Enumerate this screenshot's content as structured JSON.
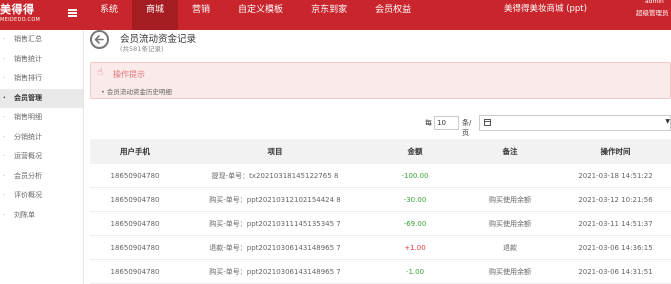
{
  "brand": {
    "name": "美得得",
    "sub": "MEIDEDO.COM"
  },
  "topnav": {
    "items": [
      {
        "label": "系统",
        "active": false
      },
      {
        "label": "商城",
        "active": true
      },
      {
        "label": "营销",
        "active": false
      },
      {
        "label": "自定义模板",
        "active": false
      },
      {
        "label": "京东到家",
        "active": false
      },
      {
        "label": "会员权益",
        "active": false
      }
    ],
    "store": "美得得美妆商城 (ppt)",
    "admin_name": "admin",
    "admin_role": "超级管理员"
  },
  "sidebar": {
    "items": [
      {
        "label": "销售汇总",
        "active": false
      },
      {
        "label": "销售统计",
        "active": false
      },
      {
        "label": "销售排行",
        "active": false
      },
      {
        "label": "会员管理",
        "active": true
      },
      {
        "label": "销售明细",
        "active": false
      },
      {
        "label": "分销统计",
        "active": false
      },
      {
        "label": "运营概况",
        "active": false
      },
      {
        "label": "会员分析",
        "active": false
      },
      {
        "label": "评价概况",
        "active": false
      },
      {
        "label": "刘陈单",
        "active": false
      }
    ]
  },
  "page": {
    "title": "会员流动资金记录",
    "subtitle": "(共581条记录)"
  },
  "tips": {
    "title": "操作提示",
    "line": "会员流动资金历史明细"
  },
  "filter": {
    "per_label": "每",
    "per_value": "10",
    "per_suffix": "条/页",
    "date_value": ""
  },
  "table": {
    "headers": [
      "用户手机",
      "项目",
      "金额",
      "备注",
      "操作时间"
    ],
    "rows": [
      {
        "phone": "18650904780",
        "item": "提现-单号：tx20210318145122765 8",
        "amount": "-100.00",
        "note": "",
        "time": "2021-03-18 14:51:22"
      },
      {
        "phone": "18650904780",
        "item": "购买-单号：ppt20210312102154424 8",
        "amount": "-30.00",
        "note": "购买使用余额",
        "time": "2021-03-12 10:21:56"
      },
      {
        "phone": "18650904780",
        "item": "购买-单号：ppt20210311145135345 7",
        "amount": "-69.00",
        "note": "购买使用余额",
        "time": "2021-03-11 14:51:37"
      },
      {
        "phone": "18650904780",
        "item": "退款-单号：ppt20210306143148965 7",
        "amount": "+1.00",
        "note": "退款",
        "time": "2021-03-06 14:36:15"
      },
      {
        "phone": "18650904780",
        "item": "购买-单号：ppt20210306143148965 7",
        "amount": "-1.00",
        "note": "购买使用余额",
        "time": "2021-03-06 14:31:51"
      }
    ]
  }
}
